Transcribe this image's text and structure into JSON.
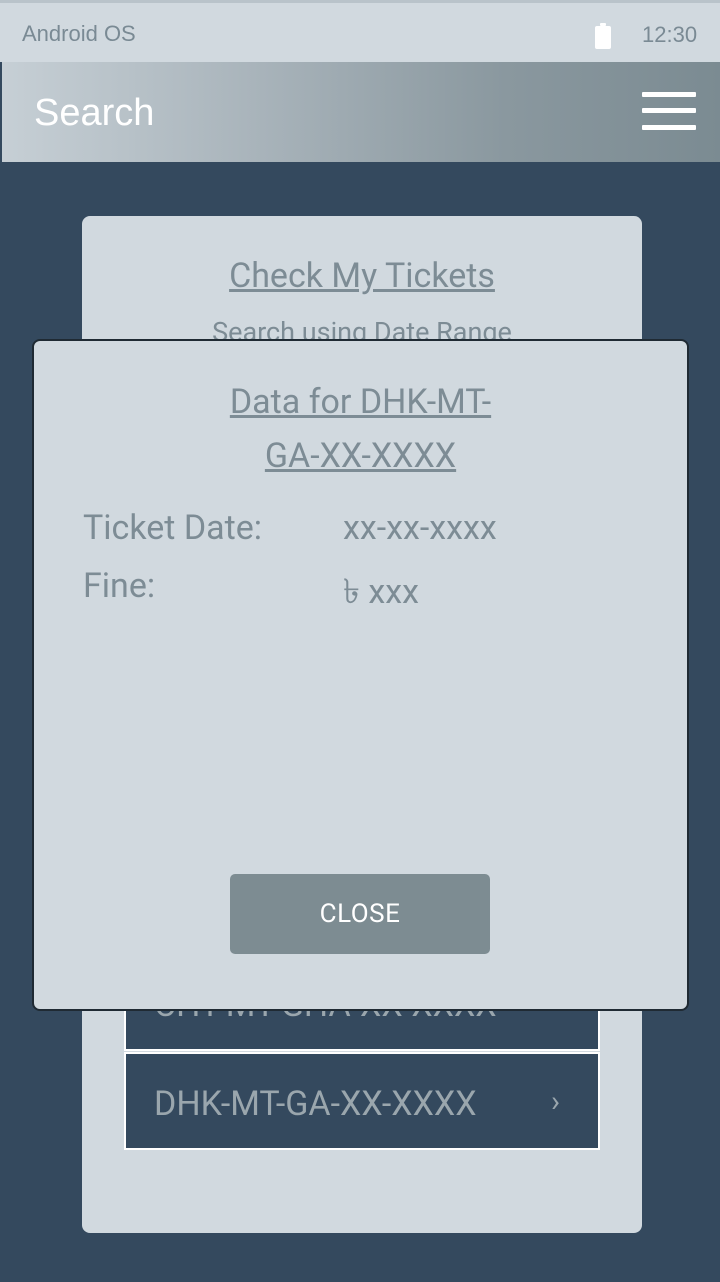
{
  "status_bar": {
    "os_label": "Android OS",
    "time": "12:30",
    "battery_icon": "battery-full-icon"
  },
  "app_bar": {
    "title": "Search",
    "menu_icon": "hamburger-menu-icon"
  },
  "background_card": {
    "title": "Check My Tickets",
    "subtitle": "Search using Date Range",
    "results": [
      {
        "label": "CHT-MT-GHA-XX-XXXX"
      },
      {
        "label": "DHK-MT-GA-XX-XXXX"
      }
    ]
  },
  "dialog": {
    "title_line1": "Data for DHK-MT-",
    "title_line2": "GA-XX-XXXX",
    "fields": [
      {
        "label": "Ticket Date:",
        "value": "xx-xx-xxxx"
      },
      {
        "label": "Fine:",
        "value": "৳ xxx"
      }
    ],
    "close_label": "CLOSE"
  },
  "colors": {
    "background": "#34495e",
    "card": "#d1d9df",
    "muted_text": "#7d8c95",
    "button": "#7d8c92"
  }
}
